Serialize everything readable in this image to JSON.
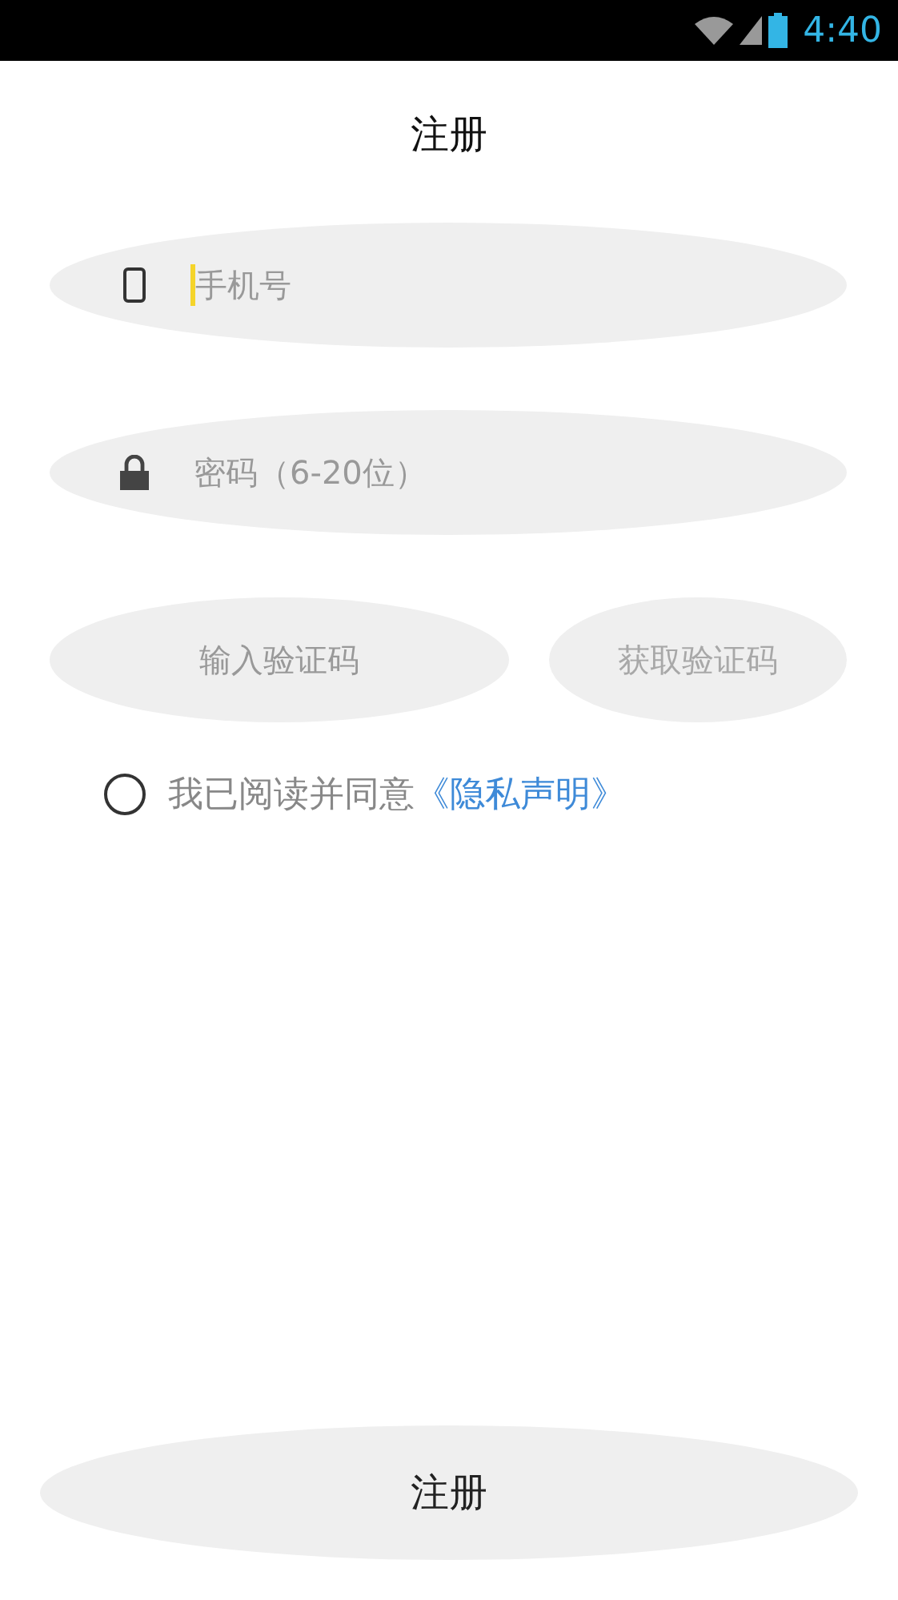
{
  "status_bar": {
    "time": "4:40"
  },
  "title": "注册",
  "fields": [
    {
      "kind": "phone",
      "placeholder": "手机号",
      "focused": true
    },
    {
      "kind": "password",
      "placeholder": "密码（6-20位）",
      "focused": false
    }
  ],
  "code": {
    "placeholder": "输入验证码",
    "button": {
      "label": "获取验证码",
      "disabled": true
    }
  },
  "agreement": {
    "checked": false,
    "text": "我已阅读并同意",
    "link": "《隐私声明》"
  },
  "submit": "注册"
}
